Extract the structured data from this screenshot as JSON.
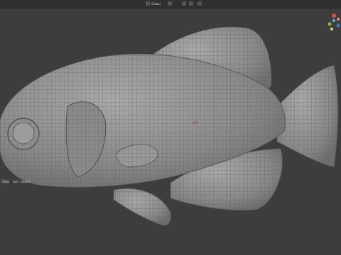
{
  "header": {
    "menus": {
      "view": "View",
      "select": "Select",
      "add": "Add",
      "object": "Object"
    },
    "transform_orientation": "Global",
    "snap_label": "⊕"
  },
  "viewport": {
    "background": "#3d3d3d",
    "mesh_color": "#8e8e8e",
    "wire_color": "#5a5a5a",
    "cursor_color": "#d04040"
  },
  "gizmo": {
    "x_color": "#e24c4c",
    "y_color": "#7fc23a",
    "z_color": "#3a7bd8"
  }
}
